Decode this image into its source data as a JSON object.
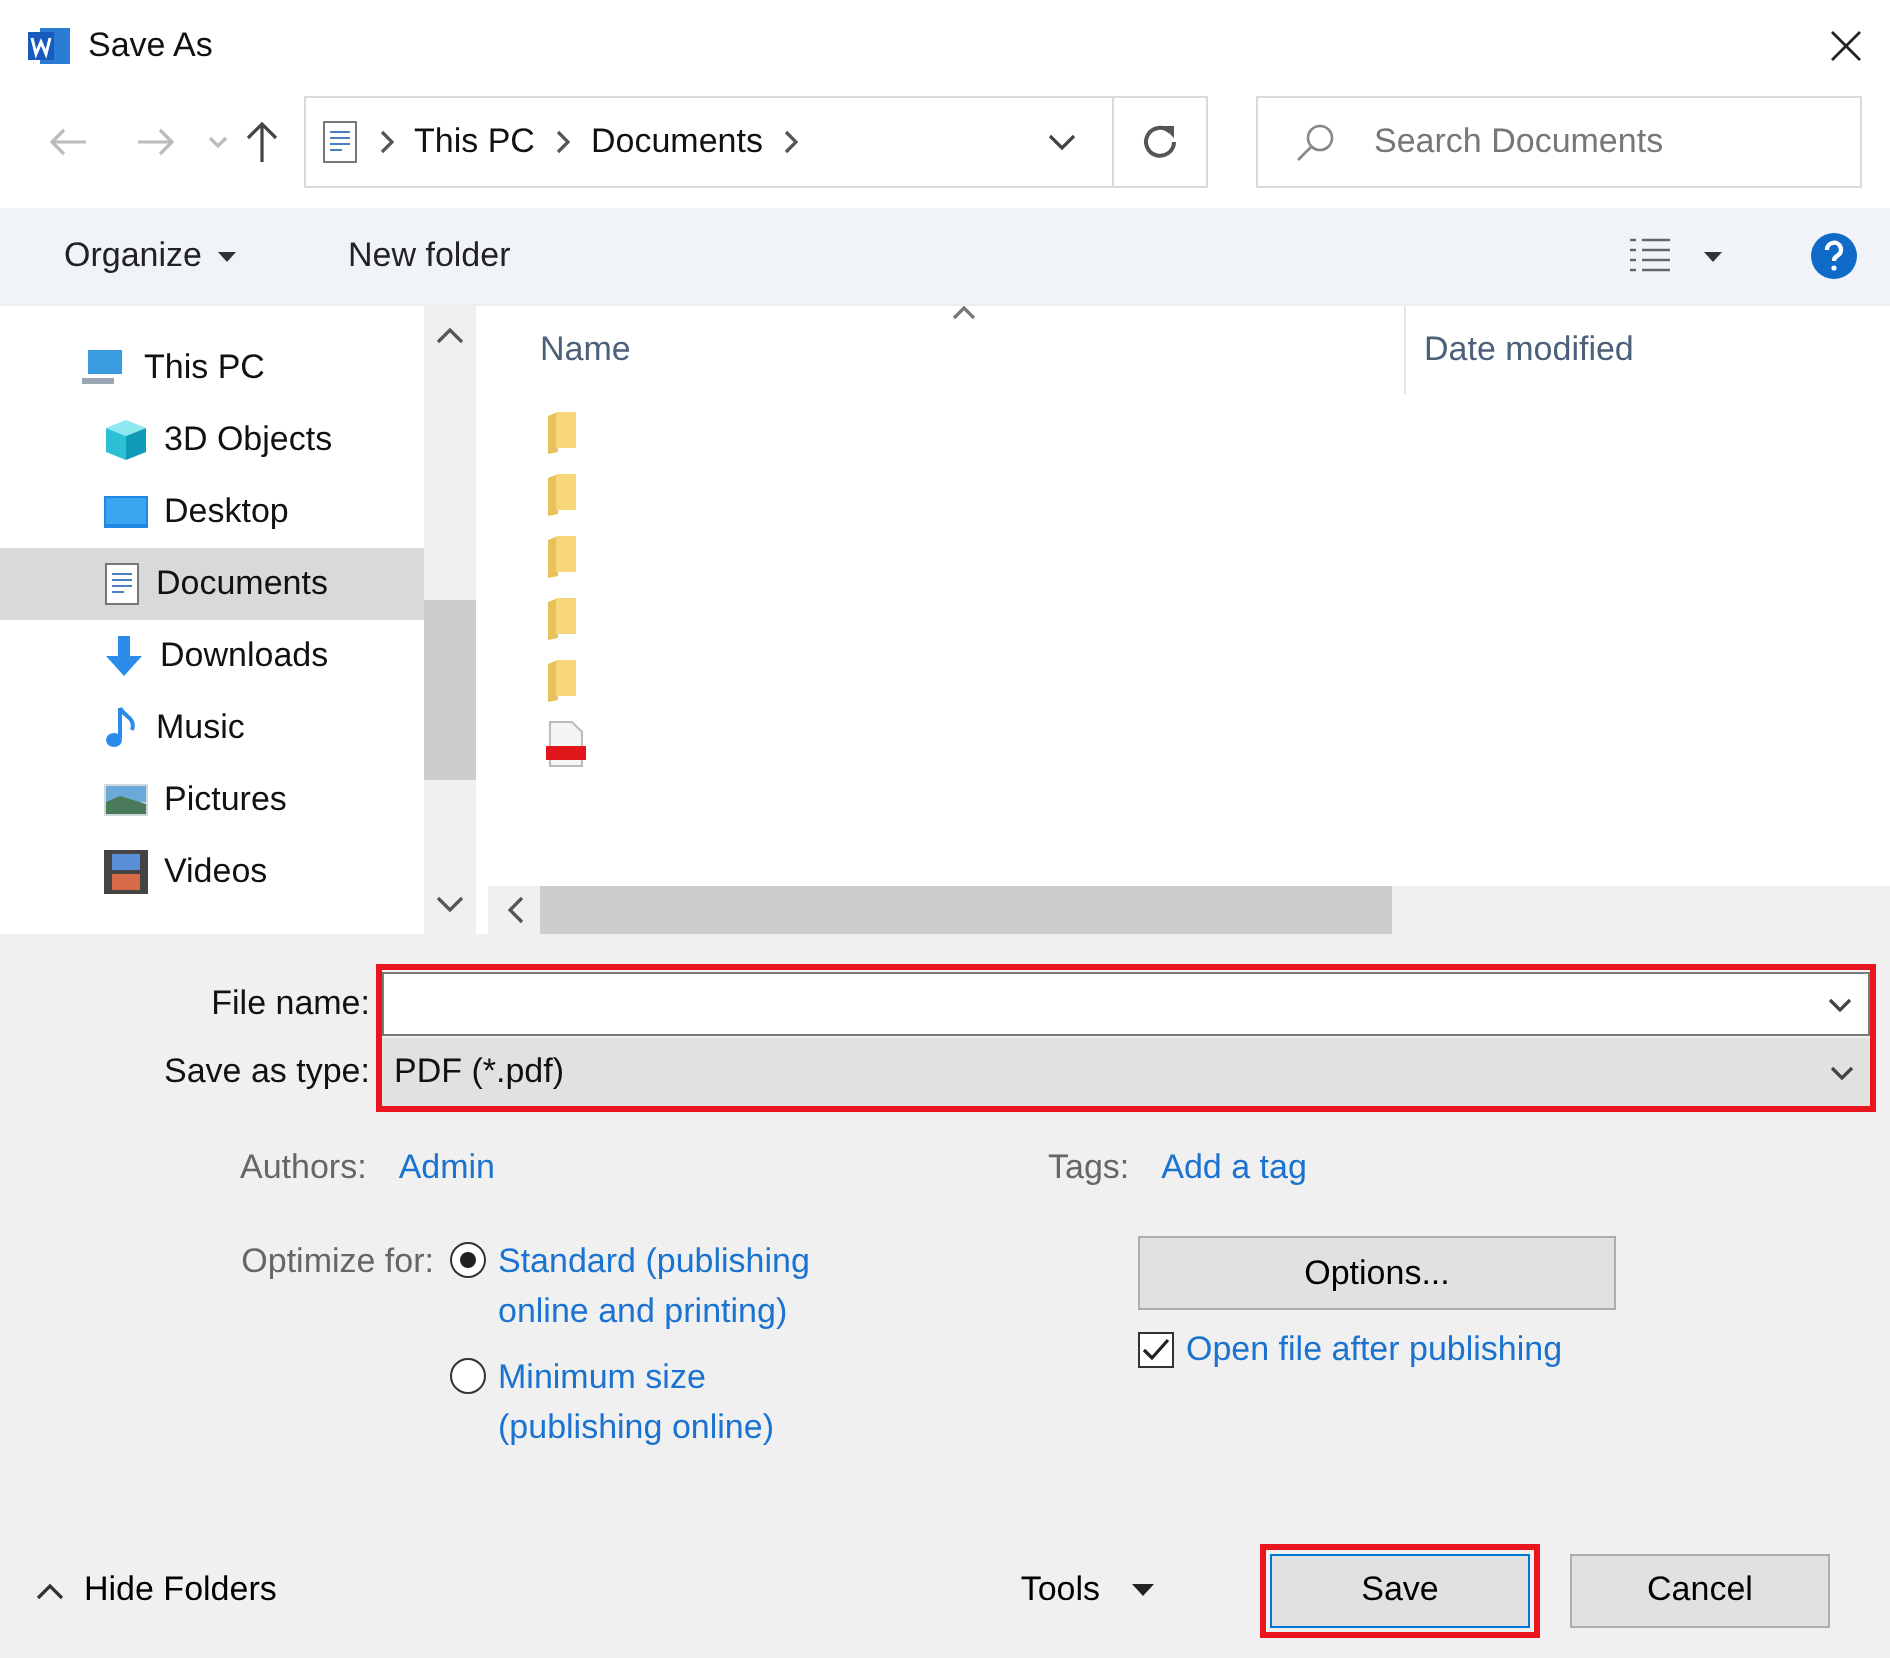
{
  "window": {
    "title": "Save As"
  },
  "address": {
    "crumbs": [
      "This PC",
      "Documents"
    ]
  },
  "search": {
    "placeholder": "Search Documents"
  },
  "toolbar": {
    "organize": "Organize",
    "new_folder": "New folder"
  },
  "nav": {
    "items": [
      {
        "label": "This PC",
        "kind": "pc",
        "selected": false,
        "children": [
          {
            "label": "3D Objects",
            "kind": "cube",
            "selected": false
          },
          {
            "label": "Desktop",
            "kind": "desktop",
            "selected": false
          },
          {
            "label": "Documents",
            "kind": "document",
            "selected": true
          },
          {
            "label": "Downloads",
            "kind": "download",
            "selected": false
          },
          {
            "label": "Music",
            "kind": "music",
            "selected": false
          },
          {
            "label": "Pictures",
            "kind": "picture",
            "selected": false
          },
          {
            "label": "Videos",
            "kind": "video",
            "selected": false
          }
        ]
      }
    ]
  },
  "columns": [
    "Name",
    "Date modified"
  ],
  "files": [
    {
      "kind": "folder"
    },
    {
      "kind": "folder"
    },
    {
      "kind": "folder"
    },
    {
      "kind": "folder"
    },
    {
      "kind": "folder"
    },
    {
      "kind": "pdf"
    }
  ],
  "file_fields": {
    "highlighted": true,
    "rows": [
      {
        "label": "File name:",
        "kind": "input"
      },
      {
        "label": "Save as type:",
        "kind": "select",
        "value": "PDF (*.pdf)"
      }
    ]
  },
  "meta": [
    {
      "label": "Authors:",
      "value": "Admin"
    },
    {
      "label": "Tags:",
      "value": "Add a tag"
    }
  ],
  "optimize": {
    "label": "Optimize for:",
    "options": [
      {
        "label": "Standard (publishing online and printing)",
        "selected": true
      },
      {
        "label": "Minimum size (publishing online)",
        "selected": false
      }
    ]
  },
  "options_button": "Options...",
  "open_after": {
    "label": "Open file after publishing",
    "checked": true
  },
  "footer": {
    "hide_folders": "Hide Folders",
    "tools": "Tools",
    "buttons": [
      {
        "label": "Save",
        "highlighted": true
      },
      {
        "label": "Cancel",
        "highlighted": false
      }
    ]
  }
}
